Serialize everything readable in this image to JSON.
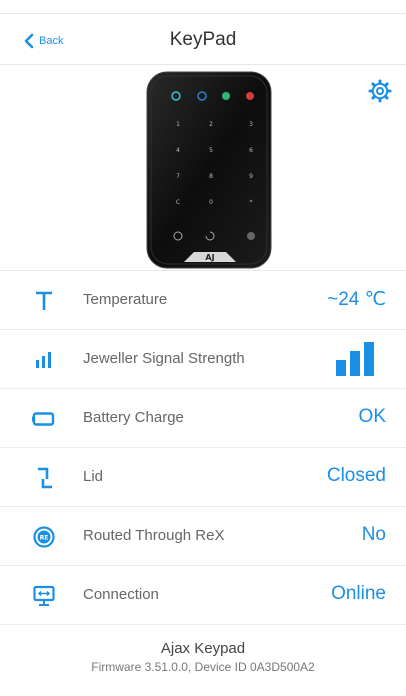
{
  "header": {
    "back_label": "Back",
    "title": "KeyPad"
  },
  "device_image": {
    "keys": [
      "1",
      "2",
      "3",
      "4",
      "5",
      "6",
      "7",
      "8",
      "9",
      "C",
      "0",
      "*"
    ],
    "brand": "AJ"
  },
  "colors": {
    "accent": "#1a8fe3"
  },
  "rows": [
    {
      "label": "Temperature",
      "value": "~24 ℃",
      "icon": "temperature-icon"
    },
    {
      "label": "Jeweller Signal Strength",
      "value": "",
      "icon": "signal-icon",
      "signal_level": 3,
      "signal_max": 3
    },
    {
      "label": "Battery Charge",
      "value": "OK",
      "icon": "battery-icon"
    },
    {
      "label": "Lid",
      "value": "Closed",
      "icon": "lid-icon"
    },
    {
      "label": "Routed Through ReX",
      "value": "No",
      "icon": "rex-icon"
    },
    {
      "label": "Connection",
      "value": "Online",
      "icon": "connection-icon"
    }
  ],
  "footer": {
    "device_name": "Ajax Keypad",
    "firmware_line": "Firmware 3.51.0.0, Device ID 0A3D500A2"
  }
}
